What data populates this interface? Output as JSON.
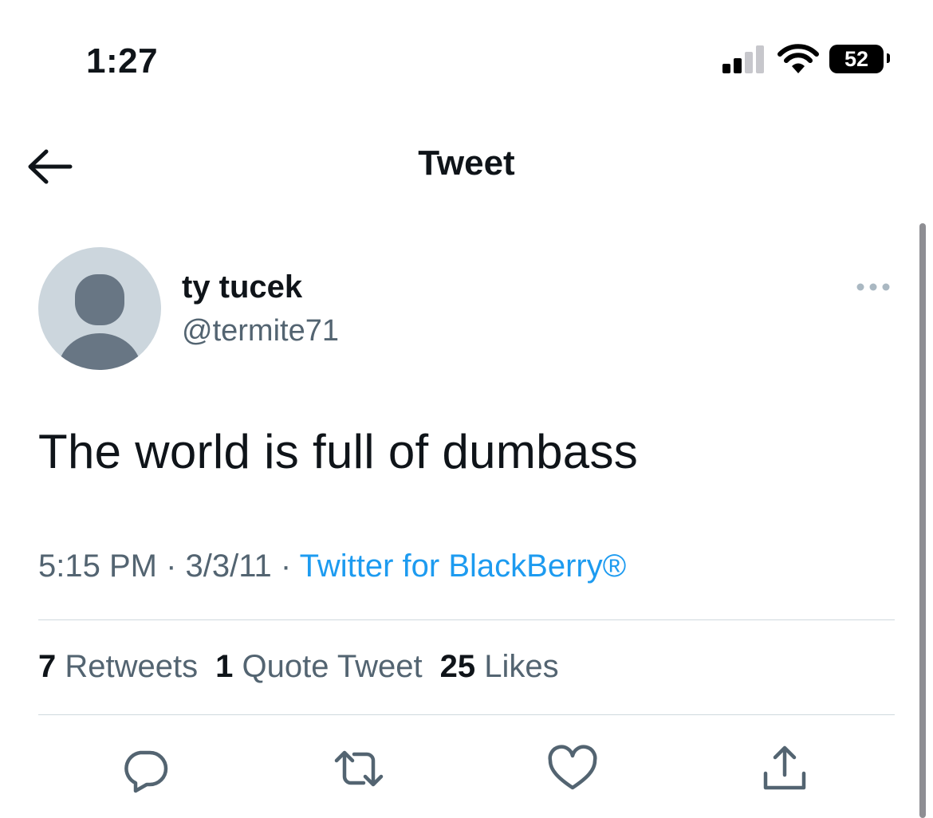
{
  "status_bar": {
    "time": "1:27",
    "battery_level": "52",
    "icons": [
      "cellular-signal-icon",
      "wifi-icon",
      "battery-icon"
    ]
  },
  "header": {
    "title": "Tweet",
    "back_icon": "arrow-left-icon"
  },
  "tweet": {
    "author": {
      "name": "ty tucek",
      "handle": "@termite71",
      "avatar": "default-avatar"
    },
    "more_icon": "more-horizontal-icon",
    "text": "The world is full of dumbass",
    "meta": {
      "time": "5:15 PM",
      "separator": "·",
      "date": "3/3/11",
      "source": "Twitter for BlackBerry®"
    },
    "stats": {
      "retweets_count": "7",
      "retweets_label": "Retweets",
      "quotes_count": "1",
      "quotes_label": "Quote Tweet",
      "likes_count": "25",
      "likes_label": "Likes"
    },
    "actions": [
      "reply-icon",
      "retweet-icon",
      "like-icon",
      "share-icon"
    ]
  },
  "colors": {
    "text_primary": "#0f1419",
    "text_secondary": "#536471",
    "link": "#1d9bf0",
    "divider": "#cfd9de",
    "avatar_bg": "#ccd6dd",
    "avatar_figure": "#687684"
  }
}
